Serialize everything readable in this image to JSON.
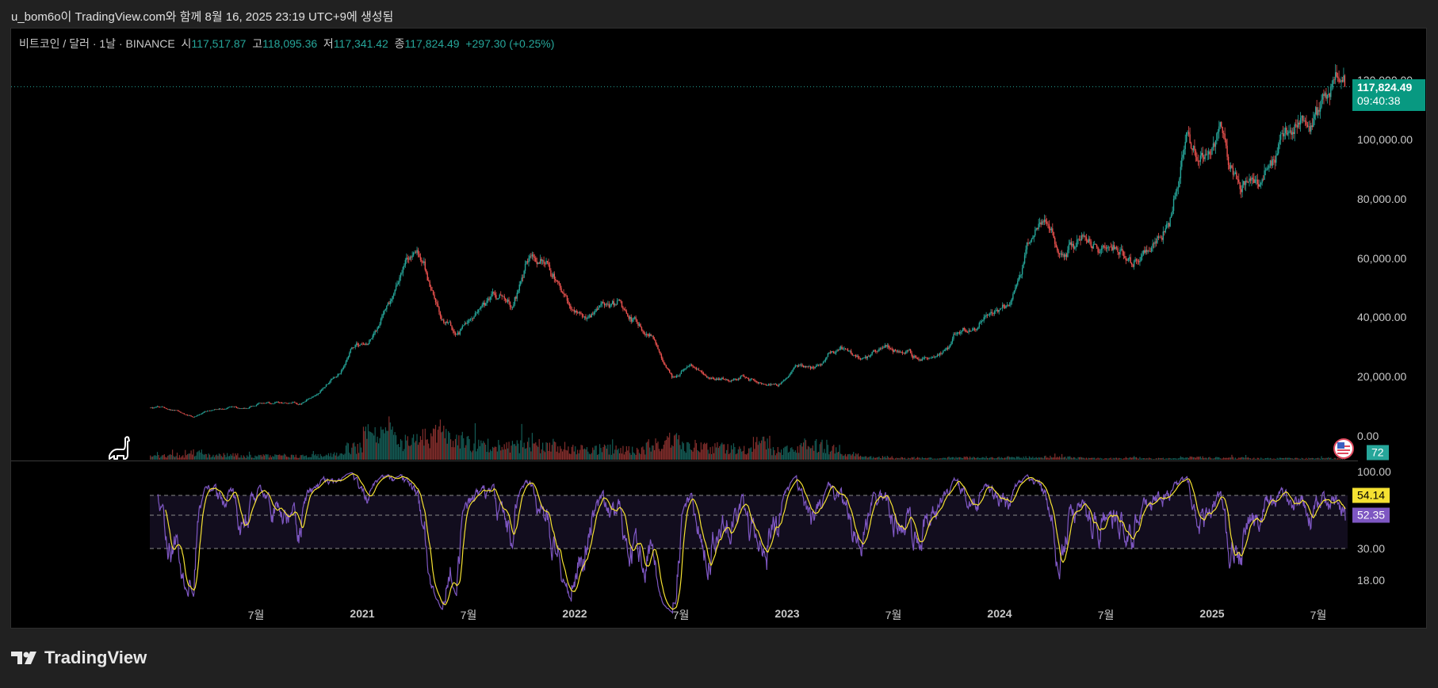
{
  "caption": "u_bom6o이 TradingView.com와 함께 8월 16, 2025 23:19 UTC+9에 생성됨",
  "legend": {
    "symbol": "비트코인 / 달러 · 1날 · BINANCE",
    "open_label": "시",
    "open": "117,517.87",
    "high_label": "고",
    "high": "118,095.36",
    "low_label": "저",
    "low": "117,341.42",
    "close_label": "종",
    "close": "117,824.49",
    "change": "+297.30 (+0.25%)"
  },
  "price_tag": {
    "price": "117,824.49",
    "countdown": "09:40:38"
  },
  "volume_badge": "72",
  "rsi_badges": {
    "ma": "54.14",
    "rsi": "52.35"
  },
  "footer_logo": "TradingView",
  "colors": {
    "up": "#26a69a",
    "down": "#ef5350",
    "rsi": "#7e57c2",
    "rsi_ma": "#f5e132",
    "tag": "#089981"
  },
  "chart_data": {
    "type": "candlestick",
    "symbol": "BTCUSD",
    "interval": "1D",
    "start": "2020-01",
    "end": "2025-08-16",
    "price_axis": {
      "ticks": [
        "120,000.00",
        "100,000.00",
        "80,000.00",
        "60,000.00",
        "40,000.00",
        "20,000.00",
        "0.00"
      ],
      "tick_values": [
        120000,
        100000,
        80000,
        60000,
        40000,
        20000,
        0
      ]
    },
    "rsi_axis": {
      "ticks": [
        "100.00",
        "30.00",
        "18.00"
      ],
      "tick_values": [
        100,
        30,
        18
      ],
      "bands": [
        70,
        50,
        30
      ]
    },
    "x_axis": {
      "ticks": [
        "7월",
        "2021",
        "7월",
        "2022",
        "7월",
        "2023",
        "7월",
        "2024",
        "7월",
        "2025",
        "7월"
      ],
      "tick_years": [
        2020.5,
        2021,
        2021.5,
        2022,
        2022.5,
        2023,
        2023.5,
        2024,
        2024.5,
        2025,
        2025.5
      ]
    },
    "monthly_close": [
      9350,
      8600,
      6400,
      8600,
      9450,
      9130,
      11350,
      11650,
      10780,
      13800,
      19700,
      29000,
      33100,
      45200,
      58800,
      57700,
      37300,
      35000,
      41500,
      47100,
      43800,
      61300,
      57000,
      46300,
      38500,
      43200,
      45500,
      37700,
      31800,
      19900,
      23300,
      20050,
      19400,
      20500,
      17150,
      16550,
      23100,
      23150,
      28500,
      29250,
      27200,
      30450,
      29250,
      25950,
      26950,
      34650,
      37700,
      42300,
      42600,
      61200,
      71300,
      60700,
      67500,
      62700,
      64600,
      59000,
      63300,
      70300,
      96400,
      93400,
      102400,
      84350,
      82550,
      94200,
      104600,
      107100,
      115750,
      117824
    ],
    "monthly_volume_rel": [
      0.08,
      0.08,
      0.15,
      0.1,
      0.1,
      0.07,
      0.08,
      0.08,
      0.08,
      0.08,
      0.12,
      0.25,
      0.5,
      0.55,
      0.4,
      0.45,
      0.6,
      0.4,
      0.3,
      0.3,
      0.28,
      0.3,
      0.3,
      0.25,
      0.22,
      0.22,
      0.2,
      0.2,
      0.3,
      0.4,
      0.3,
      0.25,
      0.25,
      0.2,
      0.35,
      0.2,
      0.3,
      0.3,
      0.25,
      0.1,
      0.06,
      0.06,
      0.04,
      0.04,
      0.04,
      0.05,
      0.05,
      0.05,
      0.05,
      0.05,
      0.06,
      0.05,
      0.04,
      0.03,
      0.03,
      0.04,
      0.03,
      0.03,
      0.05,
      0.05,
      0.04,
      0.04,
      0.03,
      0.03,
      0.03,
      0.03,
      0.03,
      0.03
    ]
  }
}
